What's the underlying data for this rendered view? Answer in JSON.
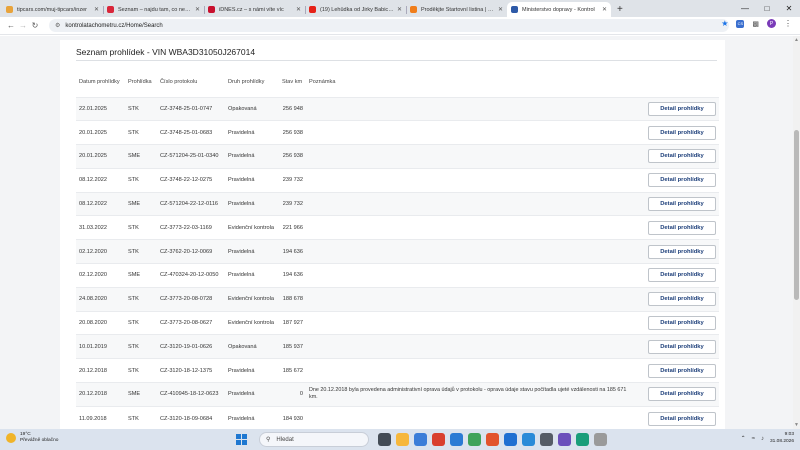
{
  "browser": {
    "tabs": [
      {
        "title": "tipcars.com/muj-tipcars/inzer",
        "icon_color": "#e8a33b",
        "active": false
      },
      {
        "title": "Seznam – najdu tam, co neznám",
        "icon_color": "#d9263a",
        "active": false
      },
      {
        "title": "iDNES.cz – s námi víte víc",
        "icon_color": "#c8102e",
        "active": false
      },
      {
        "title": "(19) Lehůdka od Jirky Babici N",
        "icon_color": "#e62117",
        "active": false
      },
      {
        "title": "Proděkjte Startovní listina | SDI",
        "icon_color": "#f07d1a",
        "active": false
      },
      {
        "title": "Ministerstvo dopravy - Kontrol",
        "icon_color": "#2e5aa8",
        "active": true
      }
    ],
    "new_tab": "+",
    "url": "kontrolatachometru.cz/Home/Search",
    "profile_initial": "P",
    "ext_label": "CS"
  },
  "page": {
    "title": "Seznam prohlídek - VIN WBA3D31050J267014",
    "columns": {
      "date": "Datum prohlídky",
      "type": "Prohlídka",
      "protocol": "Číslo protokolu",
      "kind": "Druh prohlídky",
      "km": "Stav km",
      "note": "Poznámka"
    },
    "detail_label": "Detail prohlídky",
    "rows": [
      {
        "date": "22.01.2025",
        "type": "STK",
        "protocol": "CZ-3748-25-01-0747",
        "kind": "Opakovaná",
        "km": "256 948",
        "note": ""
      },
      {
        "date": "20.01.2025",
        "type": "STK",
        "protocol": "CZ-3748-25-01-0683",
        "kind": "Pravidelná",
        "km": "256 938",
        "note": ""
      },
      {
        "date": "20.01.2025",
        "type": "SME",
        "protocol": "CZ-571204-25-01-0340",
        "kind": "Pravidelná",
        "km": "256 938",
        "note": ""
      },
      {
        "date": "08.12.2022",
        "type": "STK",
        "protocol": "CZ-3748-22-12-0275",
        "kind": "Pravidelná",
        "km": "239 732",
        "note": ""
      },
      {
        "date": "08.12.2022",
        "type": "SME",
        "protocol": "CZ-571204-22-12-0116",
        "kind": "Pravidelná",
        "km": "239 732",
        "note": ""
      },
      {
        "date": "31.03.2022",
        "type": "STK",
        "protocol": "CZ-3773-22-03-1169",
        "kind": "Evidenční kontrola",
        "km": "221 966",
        "note": ""
      },
      {
        "date": "02.12.2020",
        "type": "STK",
        "protocol": "CZ-3762-20-12-0069",
        "kind": "Pravidelná",
        "km": "194 636",
        "note": ""
      },
      {
        "date": "02.12.2020",
        "type": "SME",
        "protocol": "CZ-470324-20-12-0050",
        "kind": "Pravidelná",
        "km": "194 636",
        "note": ""
      },
      {
        "date": "24.08.2020",
        "type": "STK",
        "protocol": "CZ-3773-20-08-0728",
        "kind": "Evidenční kontrola",
        "km": "188 678",
        "note": ""
      },
      {
        "date": "20.08.2020",
        "type": "STK",
        "protocol": "CZ-3773-20-08-0627",
        "kind": "Evidenční kontrola",
        "km": "187 927",
        "note": ""
      },
      {
        "date": "10.01.2019",
        "type": "STK",
        "protocol": "CZ-3120-19-01-0626",
        "kind": "Opakovaná",
        "km": "185 937",
        "note": ""
      },
      {
        "date": "20.12.2018",
        "type": "STK",
        "protocol": "CZ-3120-18-12-1375",
        "kind": "Pravidelná",
        "km": "185 672",
        "note": ""
      },
      {
        "date": "20.12.2018",
        "type": "SME",
        "protocol": "CZ-410945-18-12-0623",
        "kind": "Pravidelná",
        "km": "0",
        "note": "Dne 20.12.2018 byla provedena administrativní oprava údajů v protokolu - oprava údaje stavu počítadla ujeté vzdálenosti na 185 671 km."
      },
      {
        "date": "11.09.2018",
        "type": "STK",
        "protocol": "CZ-3120-18-09-0684",
        "kind": "Pravidelná",
        "km": "184 930",
        "note": ""
      }
    ]
  },
  "taskbar": {
    "weather_temp": "19°C",
    "weather_desc": "Převážně oblačno",
    "search_placeholder": "Hledat",
    "time": "9:03",
    "date": "31.08.2026",
    "app_colors": [
      "#444c56",
      "#f6b73c",
      "#3b7dd8",
      "#d93f2e",
      "#2b7bd4",
      "#3fa35a",
      "#e2532c",
      "#1f6fd1",
      "#2a8bd8",
      "#555c66",
      "#6b4fbb",
      "#1a9e7a",
      "#9a9a9a"
    ]
  }
}
